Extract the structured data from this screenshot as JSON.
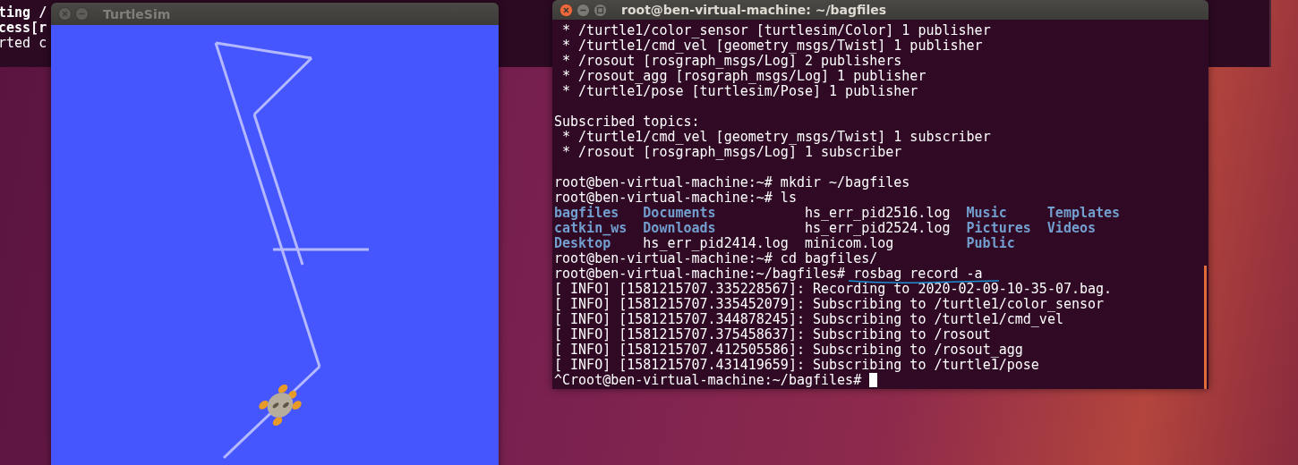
{
  "background_terminal": {
    "lines": [
      {
        "text": "ting /",
        "bold": true
      },
      {
        "text": "cess[r",
        "bold": true
      },
      {
        "text": "rted c",
        "bold": false
      }
    ]
  },
  "turtlesim": {
    "title": "TurtleSim",
    "active": false
  },
  "terminal": {
    "title": "root@ben-virtual-machine: ~/bagfiles",
    "active": true,
    "lines": [
      {
        "kind": "text",
        "text": " * /turtle1/color_sensor [turtlesim/Color] 1 publisher"
      },
      {
        "kind": "text",
        "text": " * /turtle1/cmd_vel [geometry_msgs/Twist] 1 publisher"
      },
      {
        "kind": "text",
        "text": " * /rosout [rosgraph_msgs/Log] 2 publishers"
      },
      {
        "kind": "text",
        "text": " * /rosout_agg [rosgraph_msgs/Log] 1 publisher"
      },
      {
        "kind": "text",
        "text": " * /turtle1/pose [turtlesim/Pose] 1 publisher"
      },
      {
        "kind": "blank"
      },
      {
        "kind": "text",
        "text": "Subscribed topics:"
      },
      {
        "kind": "text",
        "text": " * /turtle1/cmd_vel [geometry_msgs/Twist] 1 subscriber"
      },
      {
        "kind": "text",
        "text": " * /rosout [rosgraph_msgs/Log] 1 subscriber"
      },
      {
        "kind": "blank"
      },
      {
        "kind": "prompt",
        "prompt": "root@ben-virtual-machine:~#",
        "command": "mkdir ~/bagfiles",
        "underlined": false,
        "cursor": false
      },
      {
        "kind": "prompt",
        "prompt": "root@ben-virtual-machine:~#",
        "command": "ls",
        "underlined": false,
        "cursor": false
      },
      {
        "kind": "ls",
        "cells": [
          {
            "text": "bagfiles",
            "directory": true
          },
          {
            "text": "Documents",
            "directory": true
          },
          {
            "text": "hs_err_pid2516.log",
            "directory": false
          },
          {
            "text": "Music",
            "directory": true
          },
          {
            "text": "Templates",
            "directory": true
          }
        ]
      },
      {
        "kind": "ls",
        "cells": [
          {
            "text": "catkin_ws",
            "directory": true
          },
          {
            "text": "Downloads",
            "directory": true
          },
          {
            "text": "hs_err_pid2524.log",
            "directory": false
          },
          {
            "text": "Pictures",
            "directory": true
          },
          {
            "text": "Videos",
            "directory": true
          }
        ]
      },
      {
        "kind": "ls",
        "cells": [
          {
            "text": "Desktop",
            "directory": true
          },
          {
            "text": "hs_err_pid2414.log",
            "directory": false
          },
          {
            "text": "minicom.log",
            "directory": false
          },
          {
            "text": "Public",
            "directory": true
          }
        ]
      },
      {
        "kind": "prompt",
        "prompt": "root@ben-virtual-machine:~#",
        "command": "cd bagfiles/",
        "underlined": false,
        "cursor": false
      },
      {
        "kind": "prompt",
        "prompt": "root@ben-virtual-machine:~/bagfiles#",
        "command": "rosbag record -a",
        "underlined": true,
        "cursor": false
      },
      {
        "kind": "text",
        "text": "[ INFO] [1581215707.335228567]: Recording to 2020-02-09-10-35-07.bag."
      },
      {
        "kind": "text",
        "text": "[ INFO] [1581215707.335452079]: Subscribing to /turtle1/color_sensor"
      },
      {
        "kind": "text",
        "text": "[ INFO] [1581215707.344878245]: Subscribing to /turtle1/cmd_vel"
      },
      {
        "kind": "text",
        "text": "[ INFO] [1581215707.375458637]: Subscribing to /rosout"
      },
      {
        "kind": "text",
        "text": "[ INFO] [1581215707.412505586]: Subscribing to /rosout_agg"
      },
      {
        "kind": "text",
        "text": "[ INFO] [1581215707.431419659]: Subscribing to /turtle1/pose"
      },
      {
        "kind": "prompt",
        "prompt": "^Croot@ben-virtual-machine:~/bagfiles#",
        "underlined": false,
        "cursor": true
      }
    ]
  }
}
